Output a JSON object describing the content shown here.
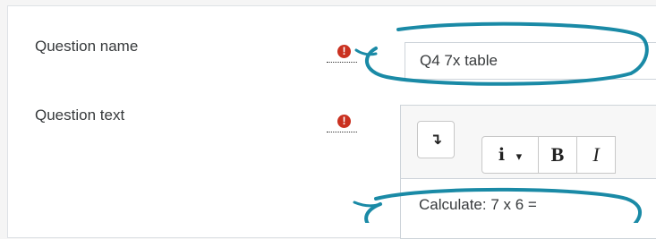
{
  "question_name": {
    "label": "Question name",
    "value": "Q4 7x table",
    "required_icon": "exclamation-circle-icon"
  },
  "question_text": {
    "label": "Question text",
    "required_icon": "exclamation-circle-icon",
    "toolbar": {
      "collapse_icon": "↴",
      "info_icon": "i",
      "dropdown_icon": "▾",
      "bold": "B",
      "italic": "I"
    },
    "content": "Calculate: 7 x 6 ="
  },
  "colors": {
    "required": "#ca3120",
    "annotation": "#1a8aa6"
  }
}
